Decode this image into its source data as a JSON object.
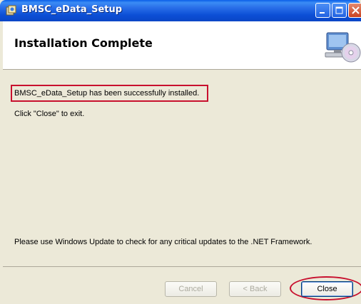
{
  "window": {
    "title": "BMSC_eData_Setup",
    "title_icon": "installer-icon",
    "controls": [
      "minimize-icon",
      "maximize-icon",
      "close-icon"
    ]
  },
  "header": {
    "title": "Installation Complete",
    "graphic": "computer-cd-icon"
  },
  "body": {
    "success_message": "BMSC_eData_Setup has been successfully installed.",
    "instruction": "Click \"Close\" to exit.",
    "update_note": "Please use Windows Update to check for any critical updates to the .NET Framework."
  },
  "buttons": {
    "cancel": "Cancel",
    "back": "< Back",
    "close": "Close"
  },
  "colors": {
    "titlebar": "#0a4fd6",
    "annotation": "#c8102e",
    "dialog_bg": "#ece9d8"
  }
}
